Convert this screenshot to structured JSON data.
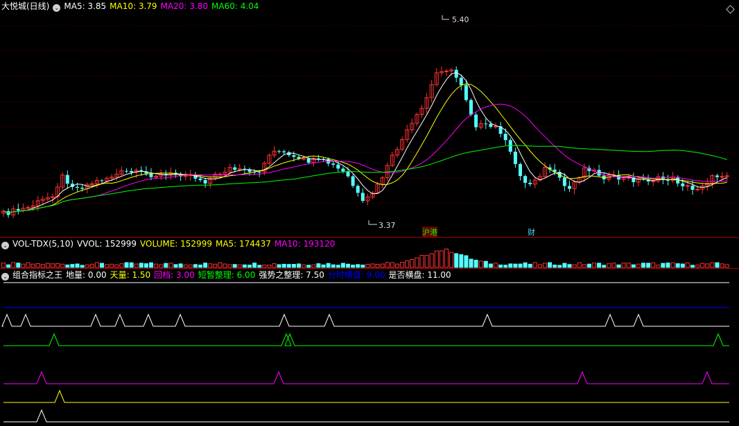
{
  "main": {
    "title": "大悦城(日线)",
    "ma": [
      {
        "label": "MA5: 3.85",
        "color": "#ffffff"
      },
      {
        "label": "MA10: 3.79",
        "color": "#ffff00"
      },
      {
        "label": "MA20: 3.80",
        "color": "#ff00ff"
      },
      {
        "label": "MA60: 4.04",
        "color": "#00ff00"
      }
    ],
    "high_label": "5.40",
    "low_label": "3.37",
    "tags": [
      {
        "text": "沪港",
        "color": "#00ff00"
      },
      {
        "text": "财",
        "color": "#5ad2ff"
      }
    ]
  },
  "volume": {
    "title": "VOL-TDX(5,10)",
    "items": [
      {
        "label": "VVOL: 152999",
        "color": "#ffffff"
      },
      {
        "label": "VOLUME: 152999",
        "color": "#ffff00"
      },
      {
        "label": "MA5: 174437",
        "color": "#ffff00"
      },
      {
        "label": "MA10: 193120",
        "color": "#ff00ff"
      }
    ]
  },
  "indicator": {
    "title": "组合指标之王",
    "items": [
      {
        "label": "地量: 0.00",
        "color": "#ffffff"
      },
      {
        "label": "天量: 1.50",
        "color": "#ffff00"
      },
      {
        "label": "回档: 3.00",
        "color": "#ff00ff"
      },
      {
        "label": "短暂整理: 6.00",
        "color": "#00ff00"
      },
      {
        "label": "强势之整理: 7.50",
        "color": "#ffffff"
      },
      {
        "label": "分时横盘: 9.00",
        "color": "#0000ff"
      },
      {
        "label": "是否横盘: 11.00",
        "color": "#ffffff"
      }
    ]
  },
  "colors": {
    "up": "#ff3232",
    "down": "#54ffff",
    "ma5": "#ffffff",
    "ma10": "#ffff00",
    "ma20": "#ff00ff",
    "ma60": "#00ff00",
    "separator": "#b00000"
  },
  "chart_data": {
    "type": "candlestick",
    "series": [
      {
        "name": "MA5",
        "value": 3.85
      },
      {
        "name": "MA10",
        "value": 3.79
      },
      {
        "name": "MA20",
        "value": 3.8
      },
      {
        "name": "MA60",
        "value": 4.04
      }
    ],
    "annotations": {
      "high": 5.4,
      "low": 3.37
    }
  }
}
